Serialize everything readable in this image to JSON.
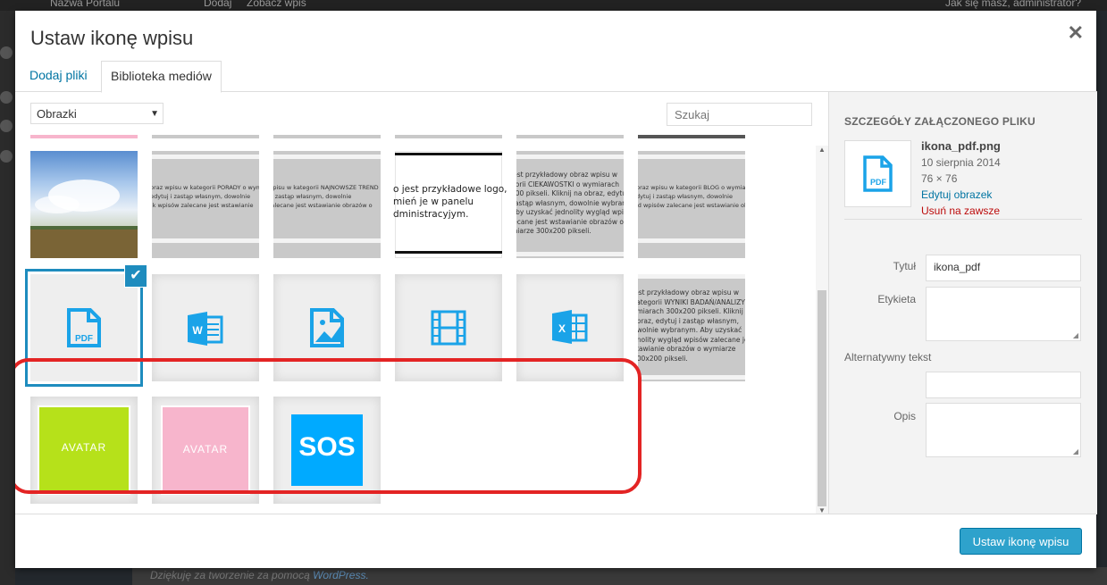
{
  "background": {
    "admin_bar": {
      "site": "Nazwa Portalu",
      "add": "Dodaj",
      "view": "Zobacz wpis",
      "greeting": "Jak się masz, administrator?"
    },
    "footer_text": "Dziękuję za tworzenie za pomocą ",
    "footer_link": "WordPress."
  },
  "modal": {
    "title": "Ustaw ikonę wpisu",
    "close_icon": "close-icon",
    "tabs": [
      {
        "label": "Dodaj pliki",
        "active": false
      },
      {
        "label": "Biblioteka mediów",
        "active": true
      }
    ]
  },
  "filter": {
    "selected": "Obrazki"
  },
  "search": {
    "placeholder": "Szukaj"
  },
  "library": {
    "grey_texts": [
      "obraz wpisu w kategorii PORADY o wymiar\n, edytuj i zastąp własnym, dowolnie\nrak wpisów zalecane jest wstawianie",
      "wpisu w kategorii NAJNOWSZE TREND\nj i zastąp własnym, dowolnie\nzalecane jest wstawianie obrazów o",
      "jest przykładowy obraz wpisu w\ngorii CIEKAWOSTKI o wymiarach\n200 pikseli. Kliknij na obraz, edytuj\nzastąp własnym, dowolnie wybranym.\nAby uzyskać jednolity wygląd wpisó\nlecane jest wstawianie obrazów o\nmiarze 300x200 pikseli.",
      "obraz wpisu w kategorii BLOG o wymiar\nedytuj i zastąp własnym, dowolnie\nlad wpisów zalecane jest wstawianie obrazów o wymiarze 800x2",
      "jest przykładowy obraz wpisu w\nkategorii WYNIKI BADAŃ/ANALIZY o\nymiarach 300x200 pikseli. Kliknij na\nobraz, edytuj i zastąp własnym,\nowolnie wybranym. Aby uzyskać\ndnolity wygląd wpisów zalecane jest\nstawianie obrazów o wymiarze\n300x200 pikseli."
    ],
    "logo_text": "o jest przykładowe logo,\nmień je w panelu\ndministracyjym.",
    "file_icons": [
      "pdf-file-icon",
      "word-file-icon",
      "image-file-icon",
      "video-file-icon",
      "excel-file-icon"
    ],
    "pdf_label": "PDF",
    "avatar_label": "AVATAR",
    "sos_label": "SOS"
  },
  "attachment": {
    "heading": "SZCZEGÓŁY ZAŁĄCZONEGO PLIKU",
    "filename": "ikona_pdf.png",
    "date": "10 sierpnia 2014",
    "dimensions": "76 × 76",
    "edit_link": "Edytuj obrazek",
    "delete_link": "Usuń na zawsze",
    "fields": {
      "title_label": "Tytuł",
      "title_value": "ikona_pdf",
      "caption_label": "Etykieta",
      "caption_value": "",
      "alt_label": "Alternatywny tekst",
      "alt_value": "",
      "description_label": "Opis",
      "description_value": ""
    }
  },
  "toolbar": {
    "submit_label": "Ustaw ikonę wpisu"
  },
  "colors": {
    "accent": "#2ea2cc",
    "selection": "#1e8cbe",
    "highlight": "#e32424",
    "lime": "#b6e11a",
    "pink": "#f7b5cc",
    "sos": "#00aaff"
  }
}
